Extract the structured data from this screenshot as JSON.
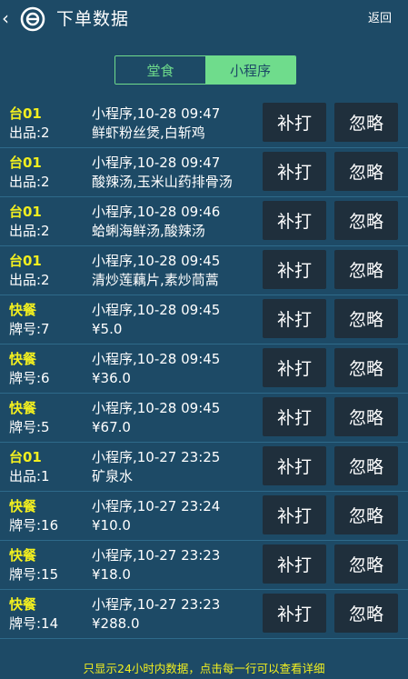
{
  "header": {
    "back_glyph": "‹",
    "logo_icon": "app-logo-icon",
    "title": "下单数据",
    "return_label": "返回"
  },
  "tabs": [
    {
      "label": "堂食",
      "active": false
    },
    {
      "label": "小程序",
      "active": true
    }
  ],
  "orders": [
    {
      "tag": "台01",
      "sub": "出品:2",
      "time": "小程序,10-28 09:47",
      "detail": "鲜虾粉丝煲,白斩鸡",
      "reprint": "补打",
      "ignore": "忽略"
    },
    {
      "tag": "台01",
      "sub": "出品:2",
      "time": "小程序,10-28 09:47",
      "detail": "酸辣汤,玉米山药排骨汤",
      "reprint": "补打",
      "ignore": "忽略"
    },
    {
      "tag": "台01",
      "sub": "出品:2",
      "time": "小程序,10-28 09:46",
      "detail": "蛤蜊海鲜汤,酸辣汤",
      "reprint": "补打",
      "ignore": "忽略"
    },
    {
      "tag": "台01",
      "sub": "出品:2",
      "time": "小程序,10-28 09:45",
      "detail": "清炒莲藕片,素炒茼蒿",
      "reprint": "补打",
      "ignore": "忽略"
    },
    {
      "tag": "快餐",
      "sub": "牌号:7",
      "time": "小程序,10-28 09:45",
      "detail": "¥5.0",
      "reprint": "补打",
      "ignore": "忽略"
    },
    {
      "tag": "快餐",
      "sub": "牌号:6",
      "time": "小程序,10-28 09:45",
      "detail": "¥36.0",
      "reprint": "补打",
      "ignore": "忽略"
    },
    {
      "tag": "快餐",
      "sub": "牌号:5",
      "time": "小程序,10-28 09:45",
      "detail": "¥67.0",
      "reprint": "补打",
      "ignore": "忽略"
    },
    {
      "tag": "台01",
      "sub": "出品:1",
      "time": "小程序,10-27 23:25",
      "detail": "矿泉水",
      "reprint": "补打",
      "ignore": "忽略"
    },
    {
      "tag": "快餐",
      "sub": "牌号:16",
      "time": "小程序,10-27 23:24",
      "detail": "¥10.0",
      "reprint": "补打",
      "ignore": "忽略"
    },
    {
      "tag": "快餐",
      "sub": "牌号:15",
      "time": "小程序,10-27 23:23",
      "detail": "¥18.0",
      "reprint": "补打",
      "ignore": "忽略"
    },
    {
      "tag": "快餐",
      "sub": "牌号:14",
      "time": "小程序,10-27 23:23",
      "detail": "¥288.0",
      "reprint": "补打",
      "ignore": "忽略"
    }
  ],
  "footer": {
    "note": "只显示24小时内数据，点击每一行可以查看详细"
  },
  "colors": {
    "background": "#1d4a66",
    "accent_green": "#6fdc8c",
    "highlight_yellow": "#f2ef1f",
    "button_bg": "#1f2f3c"
  }
}
